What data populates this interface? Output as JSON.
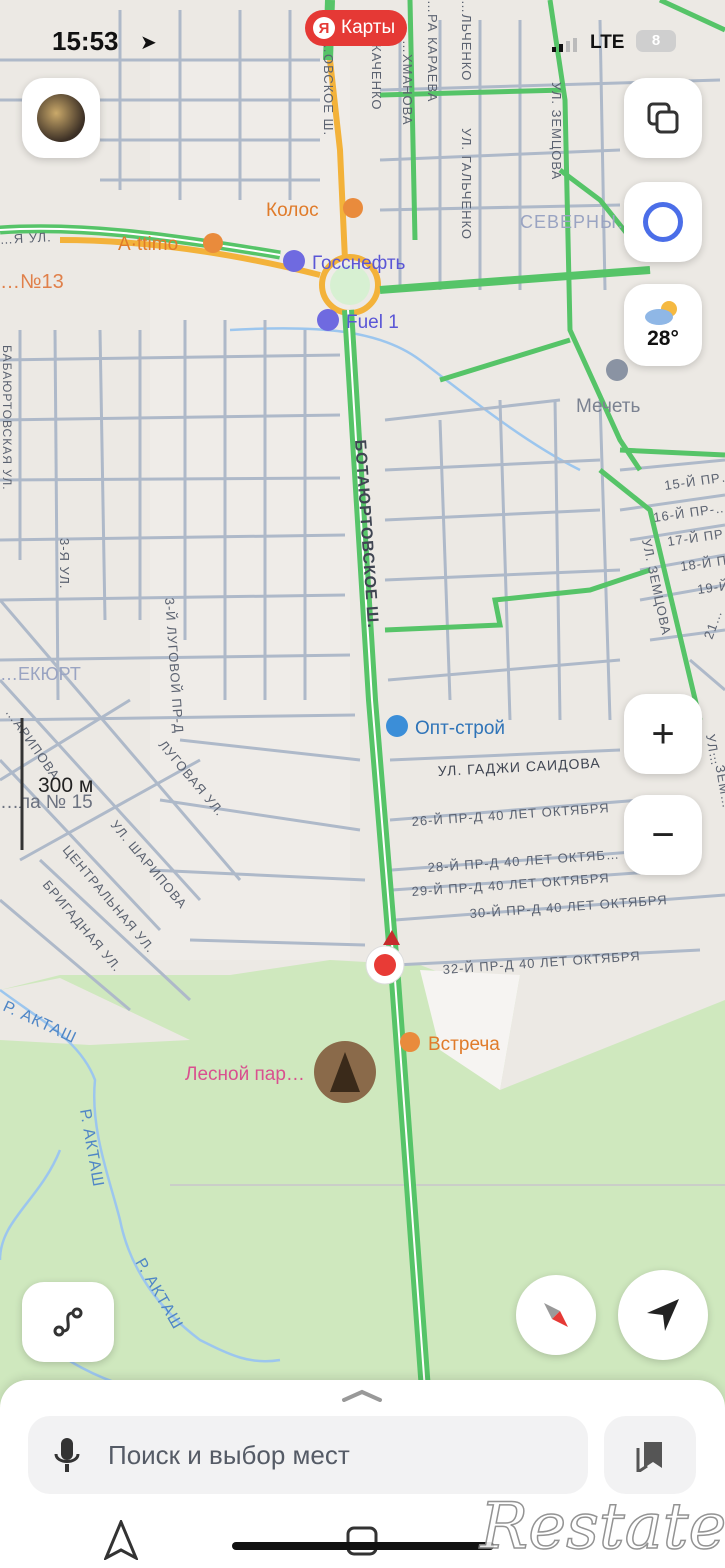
{
  "status_bar": {
    "time": "15:53",
    "network": "LTE",
    "battery": "8"
  },
  "app_badge": {
    "label": "Карты",
    "logo_letter": "Я"
  },
  "weather": {
    "temp": "28°"
  },
  "scale": {
    "label": "300 м"
  },
  "search": {
    "placeholder": "Поиск и выбор мест"
  },
  "watermark": {
    "text": "Restate"
  },
  "map": {
    "streets": {
      "botayurt_top": "…ОВСКОЕ Ш.",
      "botayurt_main": "БОТАЮРТОВСКОЕ Ш.",
      "karaeva": "…РА КАРАЕВА",
      "gal_top": "…ЛЬЧЕНКО",
      "kachenko": "…КАЧЕНКО",
      "khmanova": "…ХМАНОВА",
      "galchenko": "УЛ. ГАЛЬЧЕНКО",
      "zemtsova_top": "УЛ. ЗЕМЦОВА",
      "zemtsova_right": "УЛ. ЗЕМЦОВА",
      "ya_ul": "…Я УЛ.",
      "babayurt": "БАБАЮРТОВСКАЯ УЛ.",
      "third_ya": "3-Я УЛ.",
      "lugovoy3": "3-Й ЛУГОВОЙ ПР-Д",
      "lugovaya": "ЛУГОВАЯ УЛ.",
      "sharipova_left": "…АРИПОВА",
      "sharipova": "УЛ. ШАРИПОВА",
      "centralnaya": "ЦЕНТРАЛЬНАЯ УЛ.",
      "brigadnaya": "БРИГАДНАЯ УЛ.",
      "saidova": "УЛ. ГАДЖИ САИДОВА",
      "p26": "26-Й ПР-Д 40 ЛЕТ ОКТЯБРЯ",
      "p28": "28-Й ПР-Д 40 ЛЕТ ОКТЯБ…",
      "p29": "29-Й ПР-Д 40 ЛЕТ ОКТЯБРЯ",
      "p30": "30-Й ПР-Д 40 ЛЕТ ОКТЯБРЯ",
      "p32": "32-Й ПР-Д 40 ЛЕТ ОКТЯБРЯ",
      "p15": "15-Й ПР…",
      "p16": "16-Й ПР-…",
      "p17": "17-Й ПР…",
      "p18": "18-Й П…",
      "p19": "19-Й…",
      "p21": "21…",
      "ul_right": "УЛ…",
      "zemtsova_small": "…ЗЕМ…",
      "aktash1": "Р. АКТАШ",
      "aktash2": "Р. АКТАШ",
      "aktash3": "Р. АКТАШ"
    },
    "areas": {
      "severny": "СЕВЕРНЫ…",
      "ekyurt": "…ЕКЮРТ",
      "no13": "…№13",
      "no15": "…ла № 15"
    },
    "pois": {
      "kolos": "Колос",
      "attimo": "A·ttimo",
      "gosneft": "Госснефть",
      "fuel1": "Fuel 1",
      "mosque": "Мечеть",
      "optstroy": "Опт-строй",
      "vstrecha": "Встреча",
      "lesnoy": "Лесной пар…"
    },
    "colors": {
      "road_green": "#56c468",
      "road_yellow": "#f3b23a",
      "water": "#9cc6ee",
      "park": "#cfe8be",
      "street_line": "#aeb9c9",
      "marker": "#e83b36"
    }
  }
}
